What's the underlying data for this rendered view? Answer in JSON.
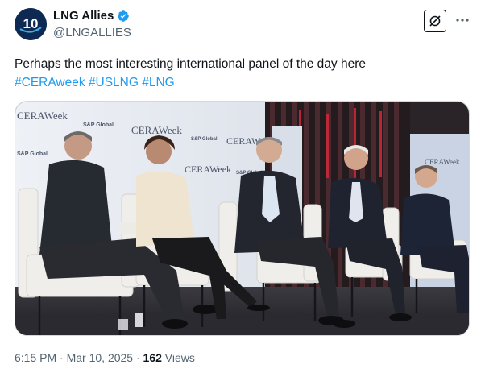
{
  "author": {
    "display_name": "LNG Allies",
    "handle": "@LNGALLIES",
    "avatar_text": "10",
    "verified": true
  },
  "tweet": {
    "text": "Perhaps the most interesting international panel of the day here",
    "hashtags": [
      "#CERAweek",
      "#USLNG",
      "#LNG"
    ]
  },
  "media": {
    "backdrop_logos": [
      "CERAWeek",
      "S&P Global"
    ]
  },
  "meta": {
    "time": "6:15 PM",
    "separator": "·",
    "date": "Mar 10, 2025",
    "views_count": "162",
    "views_label": "Views"
  },
  "icons": [
    "verified-badge-icon",
    "grok-icon",
    "more-icon"
  ],
  "colors": {
    "accent": "#1d9bf0",
    "secondary_text": "#536471",
    "avatar_bg": "#0e2a52"
  }
}
